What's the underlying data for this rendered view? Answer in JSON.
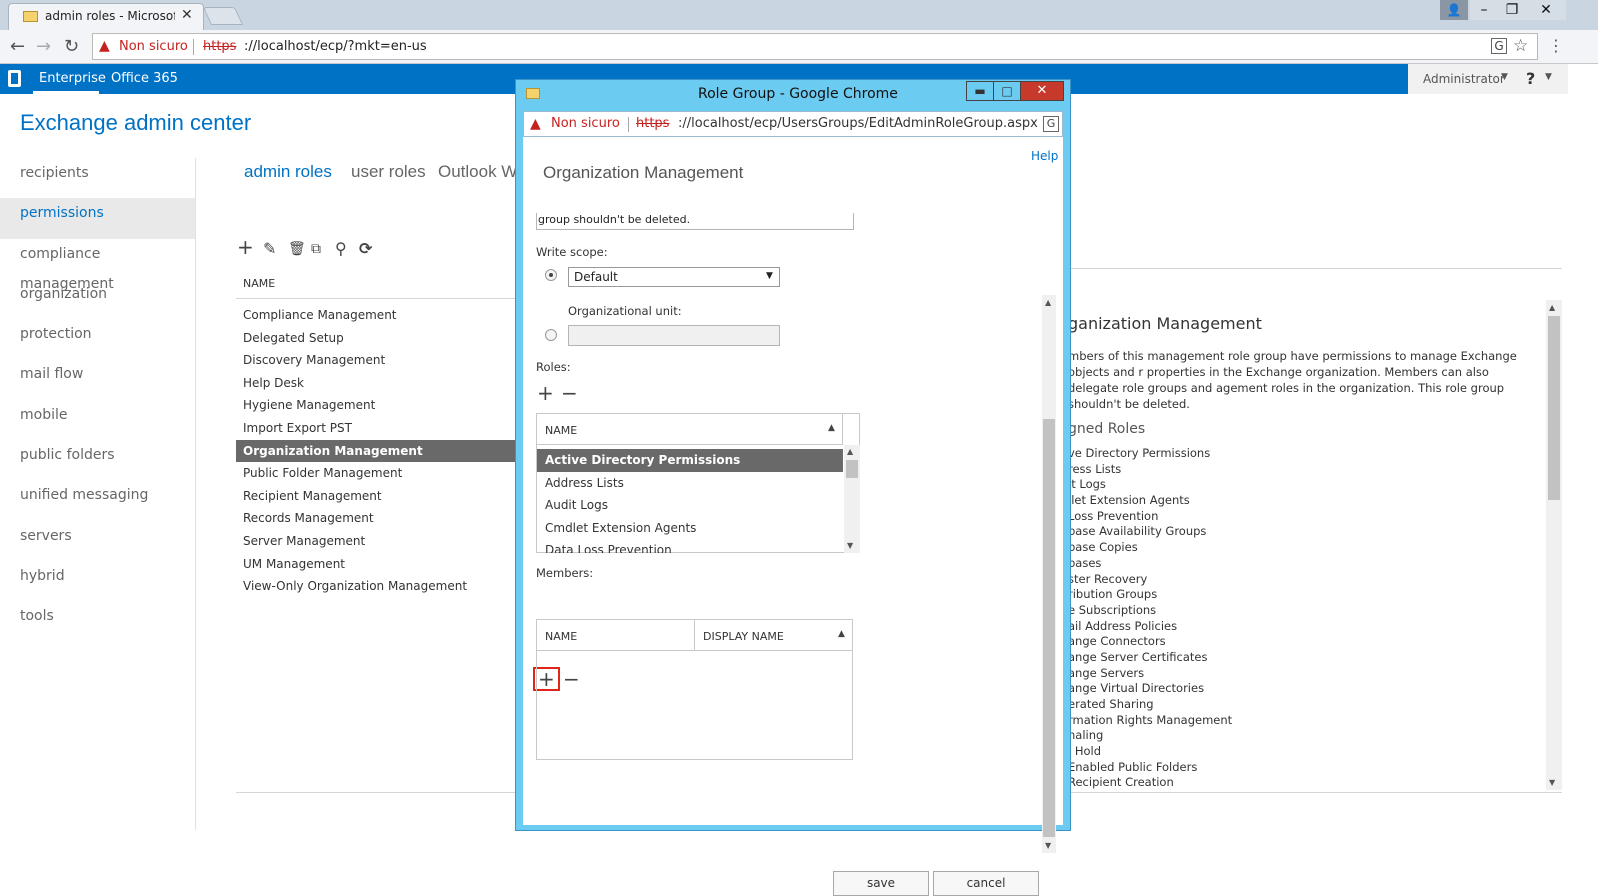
{
  "browser": {
    "tab_title": "admin roles - Microsoft E",
    "tab_close": "✕",
    "not_secure": "Non sicuro",
    "url_scheme": "https",
    "url_rest": "://localhost/ecp/?mkt=en-us",
    "window_controls": {
      "user": "👤",
      "minimize": "–",
      "maximize": "❐",
      "close": "✕"
    },
    "icons": {
      "back": "←",
      "forward": "→",
      "reload": "↻",
      "warn": "▲",
      "translate": "G",
      "star": "☆",
      "menu": "⋮"
    }
  },
  "eac_top": {
    "tabs": [
      "Enterprise",
      "Office 365"
    ],
    "admin_name": "Administrator",
    "help_mark": "?"
  },
  "eac_title": "Exchange admin center",
  "left_nav": [
    "recipients",
    "permissions",
    "compliance management",
    "organization",
    "protection",
    "mail flow",
    "mobile",
    "public folders",
    "unified messaging",
    "servers",
    "hybrid",
    "tools"
  ],
  "left_nav_selected": "permissions",
  "content_tabs": {
    "admin_roles": "admin roles",
    "user_roles": "user roles",
    "outlook": "Outlook Web App policies"
  },
  "toolbar_icons": [
    "add-icon",
    "edit-icon",
    "delete-icon",
    "copy-icon",
    "search-icon",
    "refresh-icon"
  ],
  "list": {
    "header": "NAME",
    "items": [
      "Compliance Management",
      "Delegated Setup",
      "Discovery Management",
      "Help Desk",
      "Hygiene Management",
      "Import Export PST",
      "Organization Management",
      "Public Folder Management",
      "Recipient Management",
      "Records Management",
      "Server Management",
      "UM Management",
      "View-Only Organization Management"
    ],
    "selected": "Organization Management"
  },
  "details": {
    "title": "ganization Management",
    "description": "mbers of this management role group have permissions to manage Exchange objects and r properties in the Exchange organization. Members can also delegate role groups and agement roles in the organization. This role group shouldn't be deleted.",
    "assigned_title": "gned Roles",
    "assigned_roles": [
      "ve Directory Permissions",
      "ress Lists",
      "it Logs",
      "llet Extension Agents",
      "Loss Prevention",
      "base Availability Groups",
      "base Copies",
      "bases",
      "ster Recovery",
      "ribution Groups",
      "e Subscriptions",
      "ail Address Policies",
      "ange Connectors",
      "ange Server Certificates",
      "ange Servers",
      "ange Virtual Directories",
      "erated Sharing",
      "rmation Rights Management",
      "naling",
      "l Hold",
      "Enabled Public Folders",
      "Recipient Creation"
    ]
  },
  "popup": {
    "title": "Role Group - Google Chrome",
    "controls": {
      "minimize": "▬",
      "maximize": "□",
      "close": "✕"
    },
    "not_secure": "Non sicuro",
    "url_scheme": "https",
    "url_rest": "://localhost/ecp/UsersGroups/EditAdminRoleGroup.aspx?pwmcid=",
    "help": "Help",
    "heading": "Organization Management",
    "desc_tail": "group shouldn't be deleted.",
    "write_scope_label": "Write scope:",
    "scope_value": "Default",
    "ou_label": "Organizational unit:",
    "roles_label": "Roles:",
    "roles_header": "NAME",
    "roles": [
      "Active Directory Permissions",
      "Address Lists",
      "Audit Logs",
      "Cmdlet Extension Agents",
      "Data Loss Prevention"
    ],
    "roles_selected": "Active Directory Permissions",
    "members_label": "Members:",
    "members_col_name": "NAME",
    "members_col_display": "DISPLAY NAME",
    "add_glyph": "+",
    "remove_glyph": "−",
    "save": "save",
    "cancel": "cancel"
  },
  "colors": {
    "accent": "#0072c6",
    "popup_frame": "#6ccbf0",
    "selected_row": "#696969",
    "highlight": "#e0251b"
  }
}
